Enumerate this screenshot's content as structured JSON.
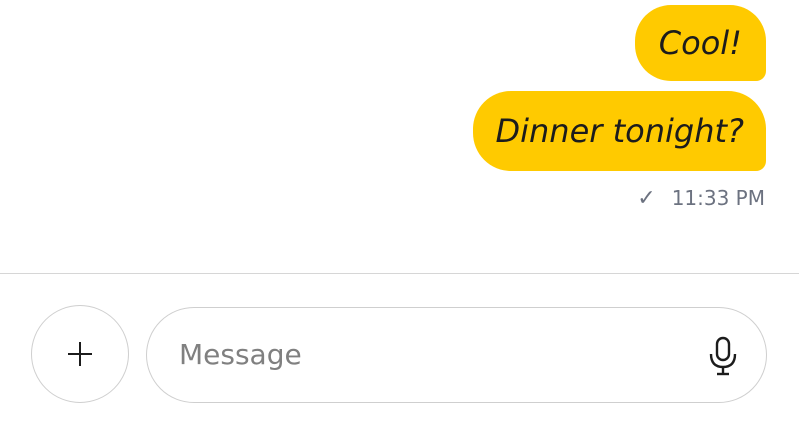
{
  "messages": [
    {
      "text": "Cool!",
      "direction": "outgoing"
    },
    {
      "text": "Dinner tonight?",
      "direction": "outgoing"
    }
  ],
  "status": {
    "check": "✓",
    "time": "11:33 PM"
  },
  "composer": {
    "placeholder": "Message",
    "value": "",
    "add_icon": "plus-icon",
    "voice_icon": "microphone-icon"
  },
  "colors": {
    "bubble": "#ffca00",
    "bubble_text": "#1c1c1c",
    "status_text": "#6c7280",
    "border": "#cfcfcf"
  }
}
